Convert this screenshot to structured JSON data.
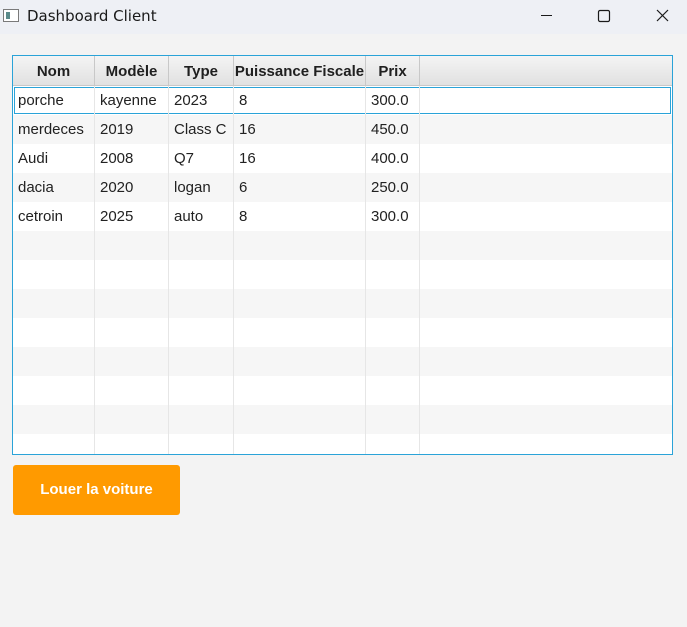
{
  "window": {
    "title": "Dashboard Client",
    "icon": "app-window-icon",
    "controls": [
      "minimize-icon",
      "maximize-icon",
      "close-icon"
    ]
  },
  "table": {
    "columns": [
      "Nom",
      "Modèle",
      "Type",
      "Puissance Fiscale",
      "Prix"
    ],
    "rows": [
      [
        "porche",
        "kayenne",
        "2023",
        "8",
        "300.0"
      ],
      [
        "merdeces",
        "2019",
        "Class C",
        "16",
        "450.0"
      ],
      [
        "Audi",
        "2008",
        "Q7",
        "16",
        "400.0"
      ],
      [
        "dacia",
        "2020",
        "logan",
        "6",
        "250.0"
      ],
      [
        "cetroin",
        "2025",
        "auto",
        "8",
        "300.0"
      ]
    ],
    "selected_row_index": 0,
    "colors": {
      "focus_border": "#2aa3d8",
      "row_alt": "#f6f6f6"
    }
  },
  "actions": {
    "rent_label": "Louer la voiture",
    "rent_color": "#ff9a00"
  }
}
